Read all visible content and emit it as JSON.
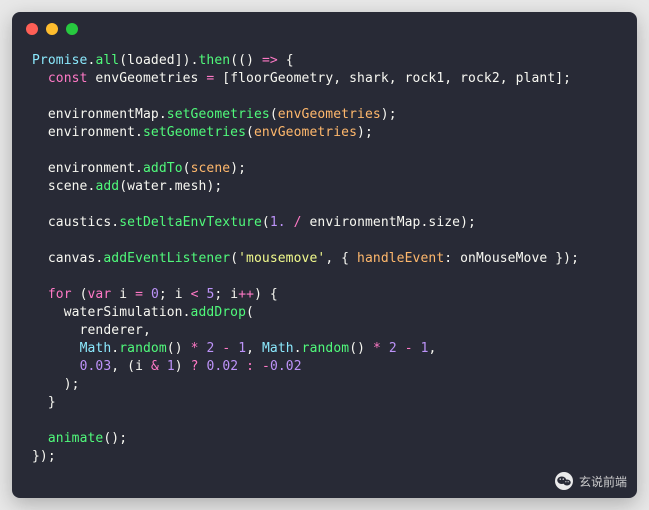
{
  "code": {
    "tokens": [
      [
        [
          "builtin",
          "Promise"
        ],
        [
          "punct",
          "."
        ],
        [
          "func",
          "all"
        ],
        [
          "punct",
          "("
        ],
        [
          "default",
          "loaded"
        ],
        [
          "punct",
          "])."
        ],
        [
          "func",
          "then"
        ],
        [
          "punct",
          "(("
        ],
        [
          "punct",
          ") "
        ],
        [
          "keyword",
          "=>"
        ],
        [
          "punct",
          " {"
        ]
      ],
      [
        [
          "punct",
          "  "
        ],
        [
          "keyword",
          "const"
        ],
        [
          "default",
          " envGeometries "
        ],
        [
          "keyword",
          "="
        ],
        [
          "default",
          " ["
        ],
        [
          "default",
          "floorGeometry"
        ],
        [
          "punct",
          ", "
        ],
        [
          "default",
          "shark"
        ],
        [
          "punct",
          ", "
        ],
        [
          "default",
          "rock1"
        ],
        [
          "punct",
          ", "
        ],
        [
          "default",
          "rock2"
        ],
        [
          "punct",
          ", "
        ],
        [
          "default",
          "plant"
        ],
        [
          "punct",
          "];"
        ]
      ],
      [
        [
          "default",
          ""
        ]
      ],
      [
        [
          "default",
          "  environmentMap"
        ],
        [
          "punct",
          "."
        ],
        [
          "func",
          "setGeometries"
        ],
        [
          "punct",
          "("
        ],
        [
          "param",
          "envGeometries"
        ],
        [
          "punct",
          ");"
        ]
      ],
      [
        [
          "default",
          "  environment"
        ],
        [
          "punct",
          "."
        ],
        [
          "func",
          "setGeometries"
        ],
        [
          "punct",
          "("
        ],
        [
          "param",
          "envGeometries"
        ],
        [
          "punct",
          ");"
        ]
      ],
      [
        [
          "default",
          ""
        ]
      ],
      [
        [
          "default",
          "  environment"
        ],
        [
          "punct",
          "."
        ],
        [
          "func",
          "addTo"
        ],
        [
          "punct",
          "("
        ],
        [
          "param",
          "scene"
        ],
        [
          "punct",
          ");"
        ]
      ],
      [
        [
          "default",
          "  scene"
        ],
        [
          "punct",
          "."
        ],
        [
          "func",
          "add"
        ],
        [
          "punct",
          "("
        ],
        [
          "default",
          "water"
        ],
        [
          "punct",
          "."
        ],
        [
          "default",
          "mesh"
        ],
        [
          "punct",
          ");"
        ]
      ],
      [
        [
          "default",
          ""
        ]
      ],
      [
        [
          "default",
          "  caustics"
        ],
        [
          "punct",
          "."
        ],
        [
          "func",
          "setDeltaEnvTexture"
        ],
        [
          "punct",
          "("
        ],
        [
          "number",
          "1."
        ],
        [
          "punct",
          " "
        ],
        [
          "keyword",
          "/"
        ],
        [
          "punct",
          " environmentMap."
        ],
        [
          "default",
          "size"
        ],
        [
          "punct",
          ");"
        ]
      ],
      [
        [
          "default",
          ""
        ]
      ],
      [
        [
          "default",
          "  canvas"
        ],
        [
          "punct",
          "."
        ],
        [
          "func",
          "addEventListener"
        ],
        [
          "punct",
          "("
        ],
        [
          "string",
          "'mousemove'"
        ],
        [
          "punct",
          ", { "
        ],
        [
          "param",
          "handleEvent"
        ],
        [
          "punct",
          ": "
        ],
        [
          "default",
          "onMouseMove"
        ],
        [
          "punct",
          " });"
        ]
      ],
      [
        [
          "default",
          ""
        ]
      ],
      [
        [
          "punct",
          "  "
        ],
        [
          "keyword",
          "for"
        ],
        [
          "punct",
          " ("
        ],
        [
          "keyword",
          "var"
        ],
        [
          "punct",
          " i "
        ],
        [
          "keyword",
          "="
        ],
        [
          "punct",
          " "
        ],
        [
          "number",
          "0"
        ],
        [
          "punct",
          "; "
        ],
        [
          "default",
          "i"
        ],
        [
          "punct",
          " "
        ],
        [
          "keyword",
          "<"
        ],
        [
          "punct",
          " "
        ],
        [
          "number",
          "5"
        ],
        [
          "punct",
          "; "
        ],
        [
          "default",
          "i"
        ],
        [
          "keyword",
          "++"
        ],
        [
          "punct",
          ") {"
        ]
      ],
      [
        [
          "default",
          "    waterSimulation"
        ],
        [
          "punct",
          "."
        ],
        [
          "func",
          "addDrop"
        ],
        [
          "punct",
          "("
        ]
      ],
      [
        [
          "default",
          "      renderer"
        ],
        [
          "punct",
          ","
        ]
      ],
      [
        [
          "punct",
          "      "
        ],
        [
          "builtin",
          "Math"
        ],
        [
          "punct",
          "."
        ],
        [
          "func",
          "random"
        ],
        [
          "punct",
          "() "
        ],
        [
          "keyword",
          "*"
        ],
        [
          "punct",
          " "
        ],
        [
          "number",
          "2"
        ],
        [
          "punct",
          " "
        ],
        [
          "keyword",
          "-"
        ],
        [
          "punct",
          " "
        ],
        [
          "number",
          "1"
        ],
        [
          "punct",
          ", "
        ],
        [
          "builtin",
          "Math"
        ],
        [
          "punct",
          "."
        ],
        [
          "func",
          "random"
        ],
        [
          "punct",
          "() "
        ],
        [
          "keyword",
          "*"
        ],
        [
          "punct",
          " "
        ],
        [
          "number",
          "2"
        ],
        [
          "punct",
          " "
        ],
        [
          "keyword",
          "-"
        ],
        [
          "punct",
          " "
        ],
        [
          "number",
          "1"
        ],
        [
          "punct",
          ","
        ]
      ],
      [
        [
          "punct",
          "      "
        ],
        [
          "number",
          "0.03"
        ],
        [
          "punct",
          ", ("
        ],
        [
          "default",
          "i"
        ],
        [
          "punct",
          " "
        ],
        [
          "keyword",
          "&"
        ],
        [
          "punct",
          " "
        ],
        [
          "number",
          "1"
        ],
        [
          "punct",
          ") "
        ],
        [
          "keyword",
          "?"
        ],
        [
          "punct",
          " "
        ],
        [
          "number",
          "0.02"
        ],
        [
          "punct",
          " "
        ],
        [
          "keyword",
          ":"
        ],
        [
          "punct",
          " "
        ],
        [
          "keyword",
          "-"
        ],
        [
          "number",
          "0.02"
        ]
      ],
      [
        [
          "punct",
          "    );"
        ]
      ],
      [
        [
          "punct",
          "  }"
        ]
      ],
      [
        [
          "default",
          ""
        ]
      ],
      [
        [
          "punct",
          "  "
        ],
        [
          "func",
          "animate"
        ],
        [
          "punct",
          "();"
        ]
      ],
      [
        [
          "punct",
          "});"
        ]
      ]
    ]
  },
  "watermark": {
    "text": "玄说前端"
  }
}
